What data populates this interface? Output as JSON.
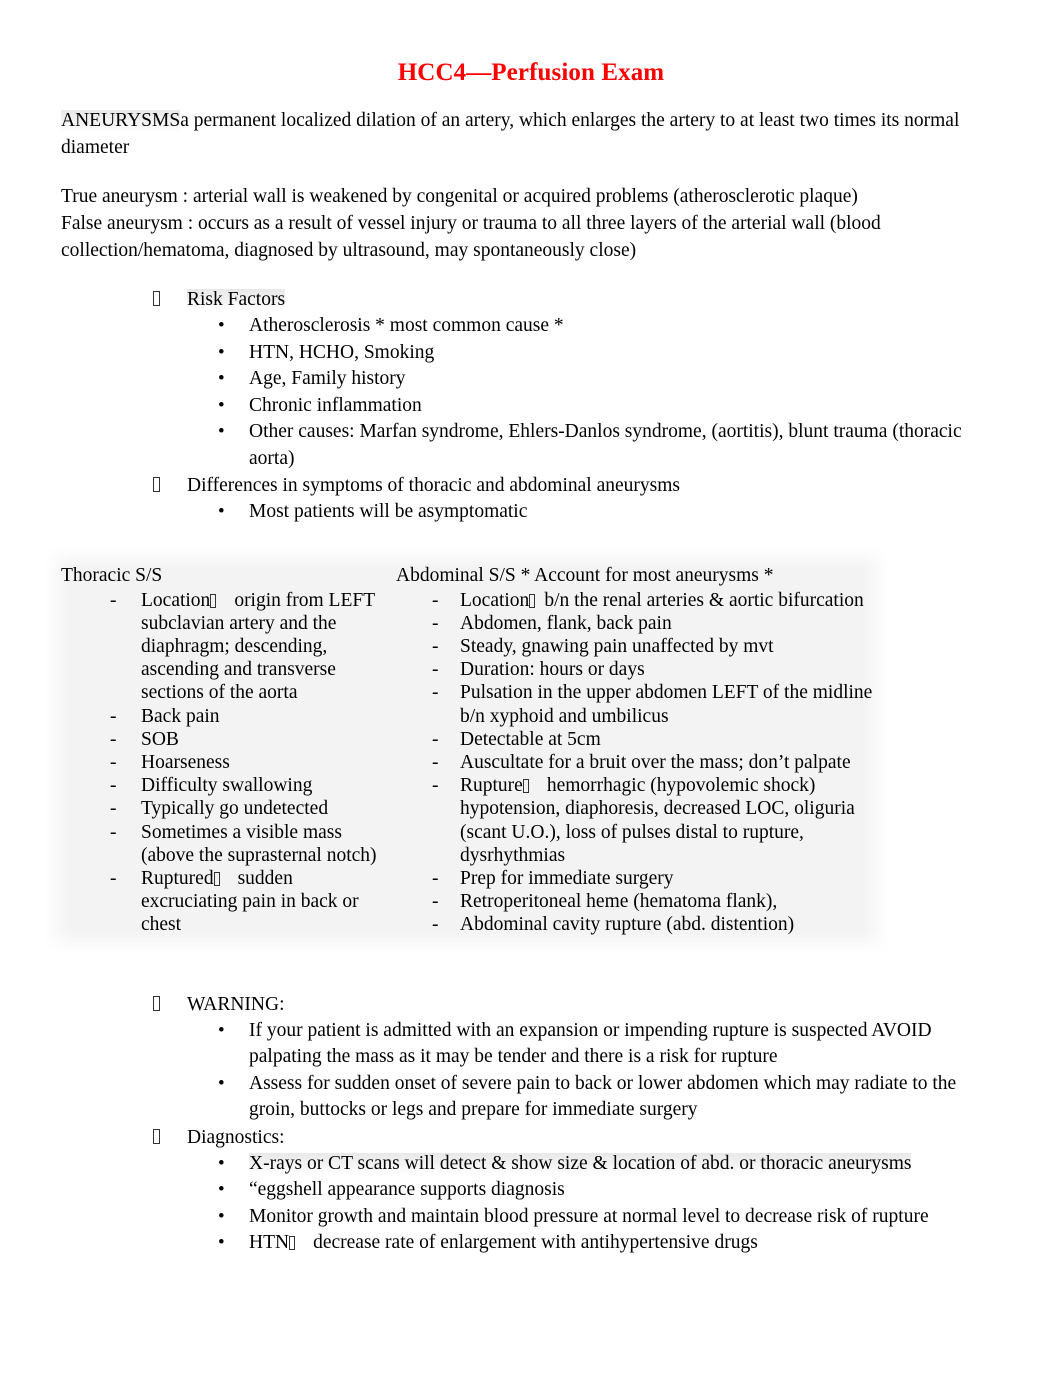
{
  "document": {
    "title": "HCC4—Perfusion Exam",
    "title_color": "#ff0000"
  },
  "intro": {
    "term": "ANEURYSMS",
    "definition": "a permanent localized dilation of an artery, which enlarges the artery to at least two times its normal diameter",
    "true_aneurysm": "True aneurysm :  arterial wall is weakened by congenital or acquired problems (atherosclerotic plaque)",
    "false_aneurysm": "False aneurysm :  occurs as a result of vessel injury or trauma to all three layers of the arterial wall (blood collection/hematoma, diagnosed by ultrasound, may spontaneously close)"
  },
  "sections": {
    "risk_factors": {
      "heading": "Risk Factors",
      "items": [
        "Atherosclerosis * most common cause *",
        "HTN, HCHO, Smoking",
        "Age, Family history",
        "Chronic inflammation",
        "Other causes:  Marfan syndrome, Ehlers-Danlos syndrome, (aortitis), blunt trauma (thoracic aorta)"
      ]
    },
    "differences": {
      "heading": "Differences in symptoms of thoracic and abdominal aneurysms",
      "items": [
        "Most patients will be asymptomatic"
      ]
    },
    "warning": {
      "heading": "WARNING:",
      "items": [
        "If your patient is admitted with an expansion or impending rupture is suspected    AVOID palpating the mass  as it may be tender and there is a risk for rupture",
        "Assess for sudden onset of severe pain to back or lower abdomen which may radiate to the groin, buttocks or legs and prepare for immediate surgery"
      ]
    },
    "diagnostics": {
      "heading": "Diagnostics:",
      "items": [
        "X-rays or CT scans will detect & show size & location of abd. or thoracic aneurysms",
        "“eggshell appearance supports diagnosis",
        "Monitor growth and maintain blood pressure at normal level to decrease risk of rupture",
        "HTN    decrease rate of enlargement with antihypertensive drugs"
      ]
    }
  },
  "table": {
    "left": {
      "header": "Thoracic S/S",
      "rows": [
        "Location   origin from LEFT subclavian artery and the diaphragm; descending, ascending and transverse sections of the aorta",
        "Back pain",
        "SOB",
        "Hoarseness",
        "Difficulty swallowing",
        "Typically go undetected",
        "Sometimes a visible mass (above the suprasternal notch)",
        "Ruptured   sudden excruciating pain in back or chest"
      ]
    },
    "right": {
      "header": "Abdominal S/S * Account for most aneurysms *",
      "rows": [
        "Location   b/n the renal arteries & aortic bifurcation",
        "Abdomen, flank, back pain",
        "Steady, gnawing pain unaffected by mvt",
        "Duration:  hours or days",
        "Pulsation in the upper abdomen LEFT of the midline b/n xyphoid and umbilicus",
        "Detectable at 5cm",
        "Auscultate for a bruit over the mass; don’t palpate",
        "Rupture   hemorrhagic (hypovolemic shock) hypotension, diaphoresis, decreased LOC, oliguria (scant U.O.), loss of pulses distal to rupture, dysrhythmias",
        "Prep for immediate surgery",
        "Retroperitoneal heme (hematoma flank),",
        "Abdominal cavity rupture (abd. distention)"
      ]
    },
    "row_parts": {
      "left_0_a": "Location",
      "left_0_b": "origin from LEFT subclavian artery and the diaphragm; descending, ascending and transverse sections of the aorta",
      "left_7_a": "Ruptured",
      "left_7_b": "sudden excruciating pain in back or chest",
      "right_0_a": "Location",
      "right_0_b": "b/n the renal arteries & aortic bifurcation",
      "right_7_a": "Rupture",
      "right_7_b": "hemorrhagic (hypovolemic shock) hypotension, diaphoresis, decreased LOC, oliguria (scant U.O.), loss of pulses distal to rupture, dysrhythmias"
    }
  },
  "diagnostics_parts": {
    "htn_a": "HTN",
    "htn_b": "decrease rate of enlargement with antihypertensive drugs"
  },
  "bullets": {
    "level1_glyph": "missing-glyph-box",
    "level2_glyph": "•",
    "dash_glyph": "-"
  }
}
